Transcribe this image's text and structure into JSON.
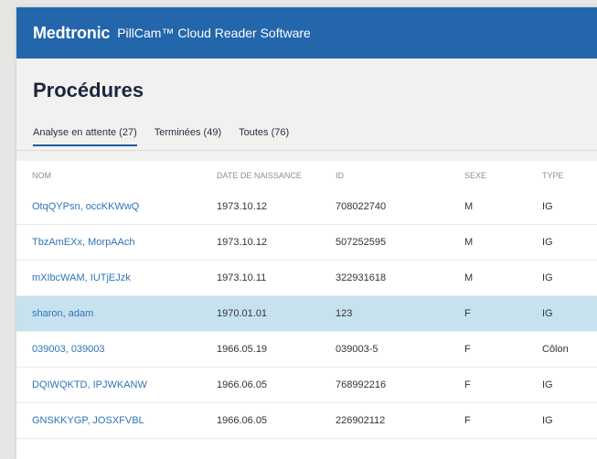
{
  "header": {
    "brand": "Medtronic",
    "product": "PillCam™ Cloud Reader Software"
  },
  "page": {
    "title": "Procédures"
  },
  "tabs": [
    {
      "label": "Analyse en attente (27)",
      "active": true
    },
    {
      "label": "Terminées (49)",
      "active": false
    },
    {
      "label": "Toutes (76)",
      "active": false
    }
  ],
  "table": {
    "columns": [
      "NOM",
      "DATE DE NAISSANCE",
      "ID",
      "SEXE",
      "TYPE"
    ],
    "rows": [
      {
        "name": "OtqQYPsn, occKKWwQ",
        "dob": "1973.10.12",
        "id": "708022740",
        "sex": "M",
        "type": "IG"
      },
      {
        "name": "TbzAmEXx, MorpAAch",
        "dob": "1973.10.12",
        "id": "507252595",
        "sex": "M",
        "type": "IG"
      },
      {
        "name": "mXIbcWAM, IUTjEJzk",
        "dob": "1973.10.11",
        "id": "322931618",
        "sex": "M",
        "type": "IG"
      },
      {
        "name": "sharon, adam",
        "dob": "1970.01.01",
        "id": "123",
        "sex": "F",
        "type": "IG",
        "selected": true
      },
      {
        "name": "039003, 039003",
        "dob": "1966.05.19",
        "id": "039003-5",
        "sex": "F",
        "type": "Côlon"
      },
      {
        "name": "DQIWQKTD, IPJWKANW",
        "dob": "1966.06.05",
        "id": "768992216",
        "sex": "F",
        "type": "IG"
      },
      {
        "name": "GNSKKYGP, JOSXFVBL",
        "dob": "1966.06.05",
        "id": "226902112",
        "sex": "F",
        "type": "IG"
      },
      {
        "name": "",
        "dob": "",
        "id": "",
        "sex": "",
        "type": "",
        "partial": true
      }
    ]
  }
}
